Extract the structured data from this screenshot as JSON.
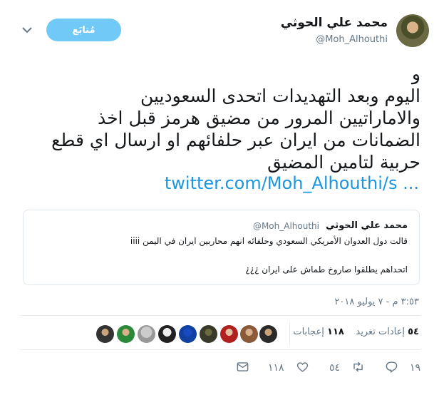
{
  "author": {
    "display_name": "محمد علي الحوثي",
    "handle": "@Moh_Alhouthi",
    "follow_label": "مُتابَع"
  },
  "tweet": {
    "lines": [
      "و",
      "اليوم وبعد التهديدات اتحدى السعوديين",
      "والاماراتيين المرور من مضيق هرمز قبل اخذ",
      "الضمانات من ايران عبر حلفائهم او ارسال اي قطع",
      "حربية لتامين المضيق"
    ],
    "link": "twitter.com/Moh_Alhouthi/s ..."
  },
  "quoted": {
    "name": "محمد علي الحوثي",
    "handle": "@Moh_Alhouthi",
    "line1": "قالت دول العدوان الأمريكي السعودي وحلفائه انهم  محاربين ايران في اليمن iiii",
    "line2": "اتحداهم يطلقوا صاروخ طماش على ايران ¿¿¿"
  },
  "timestamp": "٣:٥٣ م - ٧ يوليو ٢٠١٨",
  "stats": {
    "retweets_count": "٥٤",
    "retweets_label": "إعادات تغريد",
    "likes_count": "١١٨",
    "likes_label": "إعجابات"
  },
  "actions": {
    "reply_count": "١٩",
    "retweet_count": "٥٤",
    "like_count": "١١٨"
  },
  "colors": {
    "accent": "#1b95e0",
    "follow_bg": "#71c9f8",
    "muted": "#657786"
  },
  "icons": [
    "caret-down-icon",
    "reply-icon",
    "retweet-icon",
    "heart-icon",
    "dm-envelope-icon"
  ]
}
